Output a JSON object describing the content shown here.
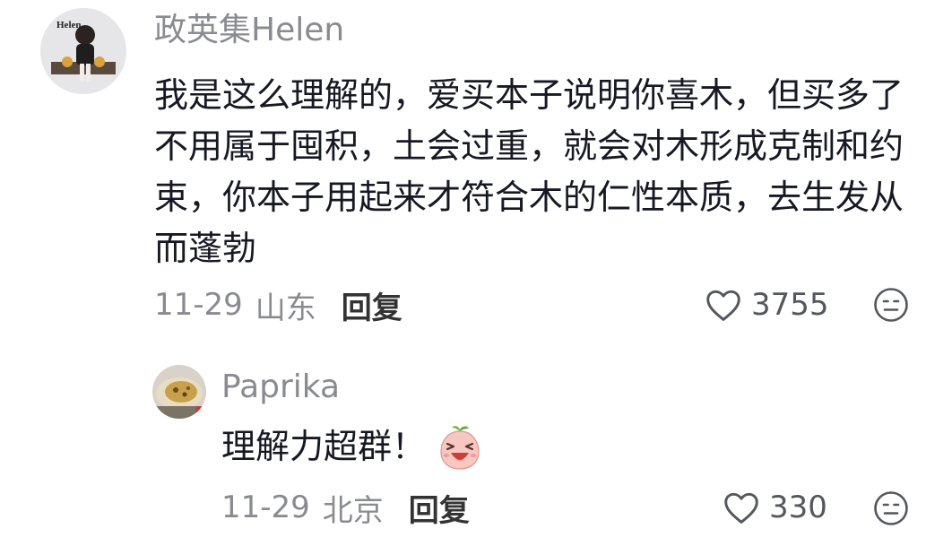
{
  "comments": [
    {
      "username": "政英集Helen",
      "avatar_text": "Helen",
      "text": "我是这么理解的，爱买本子说明你喜木，但买多了不用属于囤积，土会过重，就会对木形成克制和约束，你本子用起来才符合木的仁性本质，去生发从而蓬勃",
      "date": "11-29",
      "location": "山东",
      "reply_label": "回复",
      "like_count": "3755"
    },
    {
      "username": "Paprika",
      "text": "理解力超群！",
      "emoji": "laughing-peach",
      "date": "11-29",
      "location": "北京",
      "reply_label": "回复",
      "like_count": "330"
    }
  ],
  "icons": {
    "like": "heart-outline-icon",
    "dislike": "meh-face-icon"
  }
}
